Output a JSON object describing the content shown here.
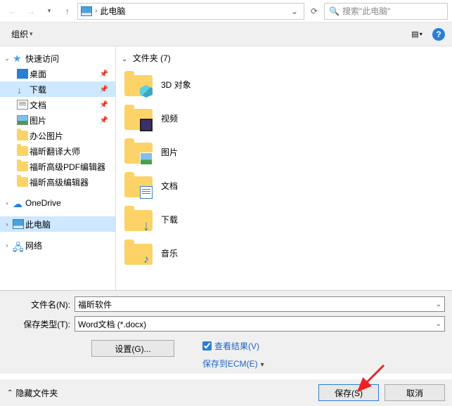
{
  "addressBar": {
    "location": "此电脑",
    "searchPlaceholder": "搜索\"此电脑\""
  },
  "toolbar": {
    "organize": "组织"
  },
  "sidebar": {
    "quickAccess": "快速访问",
    "desktop": "桌面",
    "downloads": "下载",
    "documents": "文档",
    "pictures": "图片",
    "officePics": "办公图片",
    "foxitTranslate": "福昕翻译大师",
    "foxitPdfEditor": "福昕高级PDF编辑器",
    "foxitEditor": "福昕高级编辑器",
    "oneDrive": "OneDrive",
    "thisPC": "此电脑",
    "network": "网络"
  },
  "content": {
    "sectionLabel": "文件夹 (7)",
    "items": [
      {
        "label": "3D 对象",
        "overlay": "cube"
      },
      {
        "label": "视频",
        "overlay": "film"
      },
      {
        "label": "图片",
        "overlay": "photo"
      },
      {
        "label": "文档",
        "overlay": "doc"
      },
      {
        "label": "下载",
        "overlay": "arrow-down"
      },
      {
        "label": "音乐",
        "overlay": "note"
      }
    ]
  },
  "form": {
    "fileNameLabel": "文件名(N):",
    "fileNameValue": "福昕软件",
    "fileTypeLabel": "保存类型(T):",
    "fileTypeValue": "Word文档 (*.docx)",
    "settingsBtn": "设置(G)...",
    "viewResult": "查看结果(V)",
    "saveToECM": "保存到ECM(E)"
  },
  "footer": {
    "hideFolders": "隐藏文件夹",
    "save": "保存(S)",
    "cancel": "取消"
  }
}
